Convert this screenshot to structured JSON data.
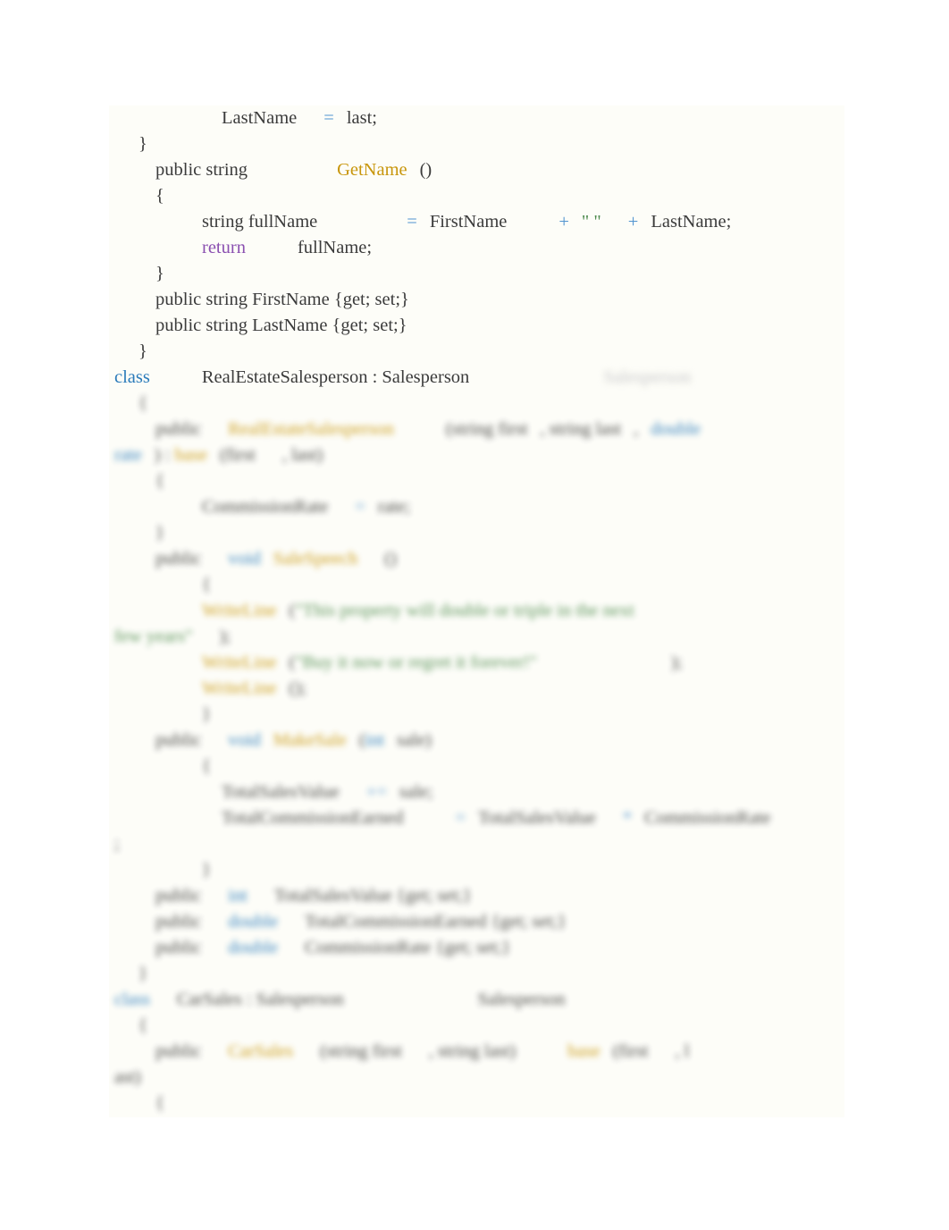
{
  "document": {
    "background_color": "#ffffff",
    "panel_color": "#fdfdf8",
    "language": "csharp",
    "syntax_colors": {
      "keyword": "#2b7bba",
      "operator": "#4f93cf",
      "return_keyword": "#8a4fb0",
      "method_name": "#c8960c",
      "string_literal": "#4c8a4c",
      "plain_text": "#3b3b3b"
    }
  },
  "code": {
    "sharp_lines": [
      {
        "id": "line-lastname-assign",
        "indent": "ind3",
        "tokens": [
          {
            "type": "plain",
            "text": "LastName"
          },
          {
            "type": "gap",
            "size": "gap-m"
          },
          {
            "type": "op",
            "text": "="
          },
          {
            "type": "gap",
            "size": "gap-s"
          },
          {
            "type": "plain",
            "text": "last;"
          }
        ]
      },
      {
        "id": "line-close-brace-ctor",
        "indent": "ind0",
        "tokens": [
          {
            "type": "plain",
            "text": "}"
          }
        ]
      },
      {
        "id": "line-getname-signature",
        "indent": "ind1",
        "tokens": [
          {
            "type": "plain",
            "text": "public string"
          },
          {
            "type": "gap",
            "size": "gap-xl"
          },
          {
            "type": "fn",
            "text": "GetName"
          },
          {
            "type": "gap",
            "size": "gap-s"
          },
          {
            "type": "plain",
            "text": "()"
          }
        ]
      },
      {
        "id": "line-open-brace-getname",
        "indent": "ind1",
        "tokens": [
          {
            "type": "plain",
            "text": "{"
          }
        ]
      },
      {
        "id": "line-fullname-assign",
        "indent": "ind2",
        "tokens": [
          {
            "type": "plain",
            "text": "string fullName"
          },
          {
            "type": "gap",
            "size": "gap-xl"
          },
          {
            "type": "op",
            "text": "="
          },
          {
            "type": "gap",
            "size": "gap-s"
          },
          {
            "type": "plain",
            "text": "FirstName"
          },
          {
            "type": "gap",
            "size": "gap-l"
          },
          {
            "type": "op",
            "text": "+"
          },
          {
            "type": "gap",
            "size": "gap-s"
          },
          {
            "type": "str",
            "text": "\" \""
          },
          {
            "type": "gap",
            "size": "gap-m"
          },
          {
            "type": "op",
            "text": "+"
          },
          {
            "type": "gap",
            "size": "gap-s"
          },
          {
            "type": "plain",
            "text": "LastName;"
          }
        ]
      },
      {
        "id": "line-return-fullname",
        "indent": "ind2",
        "tokens": [
          {
            "type": "ret",
            "text": "return"
          },
          {
            "type": "gap",
            "size": "gap-l"
          },
          {
            "type": "plain",
            "text": "fullName;"
          }
        ]
      },
      {
        "id": "line-close-brace-getname",
        "indent": "ind1",
        "tokens": [
          {
            "type": "plain",
            "text": "}"
          }
        ]
      },
      {
        "id": "line-prop-firstname",
        "indent": "ind1",
        "tokens": [
          {
            "type": "plain",
            "text": "public string FirstName {get; set;}"
          }
        ]
      },
      {
        "id": "line-prop-lastname",
        "indent": "ind1",
        "tokens": [
          {
            "type": "plain",
            "text": "public string LastName {get; set;}"
          }
        ]
      },
      {
        "id": "line-close-brace-class",
        "indent": "ind0",
        "tokens": [
          {
            "type": "plain",
            "text": "}"
          }
        ]
      },
      {
        "id": "line-class-realestatesalesperson",
        "indent": "indc",
        "tokens": [
          {
            "type": "kw",
            "text": "class"
          },
          {
            "type": "gap",
            "size": "gap-l"
          },
          {
            "type": "plain",
            "text": "RealEstateSalesperson : Salesperson"
          },
          {
            "type": "gap",
            "size": "gap-xxl"
          },
          {
            "type": "ghost",
            "text": "Salesperson"
          }
        ]
      }
    ],
    "blurred_lines": [
      {
        "id": "line-open-brace-res",
        "indent": "ind0",
        "blur": "blurred",
        "tokens": [
          {
            "type": "plain",
            "text": "{"
          }
        ]
      },
      {
        "id": "line-res-constructor",
        "indent": "ind1",
        "blur": "blurred",
        "tokens": [
          {
            "type": "plain",
            "text": "public"
          },
          {
            "type": "gap",
            "size": "gap-m"
          },
          {
            "type": "fn",
            "text": "RealEstateSalesperson"
          },
          {
            "type": "gap",
            "size": "gap-l"
          },
          {
            "type": "plain",
            "text": "(string first"
          },
          {
            "type": "gap",
            "size": "gap-s"
          },
          {
            "type": "plain",
            "text": ", string last"
          },
          {
            "type": "gap",
            "size": "gap-s"
          },
          {
            "type": "plain",
            "text": ","
          },
          {
            "type": "gap",
            "size": "gap-s"
          },
          {
            "type": "kw",
            "text": "double"
          }
        ]
      },
      {
        "id": "line-res-constructor-base",
        "indent": "indc",
        "blur": "blurred",
        "tokens": [
          {
            "type": "kw",
            "text": "rate"
          },
          {
            "type": "gap",
            "size": "gap-s"
          },
          {
            "type": "plain",
            "text": ") : "
          },
          {
            "type": "fn",
            "text": "base"
          },
          {
            "type": "gap",
            "size": "gap-s"
          },
          {
            "type": "plain",
            "text": "(first"
          },
          {
            "type": "gap",
            "size": "gap-m"
          },
          {
            "type": "plain",
            "text": ", last)"
          }
        ]
      },
      {
        "id": "line-open-brace-res-ctor",
        "indent": "ind1",
        "blur": "blurred",
        "tokens": [
          {
            "type": "plain",
            "text": "{"
          }
        ]
      },
      {
        "id": "line-commissionrate-assign",
        "indent": "ind2",
        "blur": "blurred",
        "tokens": [
          {
            "type": "plain",
            "text": "CommissionRate"
          },
          {
            "type": "gap",
            "size": "gap-m"
          },
          {
            "type": "op",
            "text": "="
          },
          {
            "type": "gap",
            "size": "gap-s"
          },
          {
            "type": "plain",
            "text": "rate;"
          }
        ]
      },
      {
        "id": "line-close-brace-res-ctor",
        "indent": "ind1",
        "blur": "blurred",
        "tokens": [
          {
            "type": "plain",
            "text": "}"
          }
        ]
      },
      {
        "id": "line-salespeech-signature",
        "indent": "ind1",
        "blur": "blurred",
        "tokens": [
          {
            "type": "plain",
            "text": "public"
          },
          {
            "type": "gap",
            "size": "gap-m"
          },
          {
            "type": "kw",
            "text": "void"
          },
          {
            "type": "gap",
            "size": "gap-s"
          },
          {
            "type": "fn",
            "text": "SaleSpeech"
          },
          {
            "type": "gap",
            "size": "gap-m"
          },
          {
            "type": "plain",
            "text": "()"
          }
        ]
      },
      {
        "id": "line-open-brace-salespeech",
        "indent": "ind2",
        "blur": "blurred",
        "tokens": [
          {
            "type": "plain",
            "text": "{"
          }
        ]
      },
      {
        "id": "line-writeline-1",
        "indent": "ind2",
        "blur": "blurred",
        "tokens": [
          {
            "type": "fn",
            "text": "WriteLine"
          },
          {
            "type": "gap",
            "size": "gap-s"
          },
          {
            "type": "plain",
            "text": "("
          },
          {
            "type": "str",
            "text": "\"This property will double or triple in the next"
          }
        ]
      },
      {
        "id": "line-writeline-1-cont",
        "indent": "indc",
        "blur": "blurred",
        "tokens": [
          {
            "type": "str",
            "text": "few years\""
          },
          {
            "type": "gap",
            "size": "gap-m"
          },
          {
            "type": "plain",
            "text": ");"
          }
        ]
      },
      {
        "id": "line-writeline-2",
        "indent": "ind2",
        "blur": "blurred",
        "tokens": [
          {
            "type": "fn",
            "text": "WriteLine"
          },
          {
            "type": "gap",
            "size": "gap-s"
          },
          {
            "type": "plain",
            "text": "("
          },
          {
            "type": "str",
            "text": "\"Buy it now or regret it forever!\""
          },
          {
            "type": "gap",
            "size": "gap-xxl"
          },
          {
            "type": "plain",
            "text": ");"
          }
        ]
      },
      {
        "id": "line-writeline-3",
        "indent": "ind2",
        "blur": "blurred",
        "tokens": [
          {
            "type": "fn",
            "text": "WriteLine"
          },
          {
            "type": "gap",
            "size": "gap-s"
          },
          {
            "type": "plain",
            "text": "();"
          }
        ]
      },
      {
        "id": "line-close-brace-salespeech",
        "indent": "ind2",
        "blur": "blurred",
        "tokens": [
          {
            "type": "plain",
            "text": "}"
          }
        ]
      },
      {
        "id": "line-makesale-signature",
        "indent": "ind1",
        "blur": "blurred",
        "tokens": [
          {
            "type": "plain",
            "text": "public"
          },
          {
            "type": "gap",
            "size": "gap-m"
          },
          {
            "type": "kw",
            "text": "void"
          },
          {
            "type": "gap",
            "size": "gap-s"
          },
          {
            "type": "fn",
            "text": "MakeSale"
          },
          {
            "type": "gap",
            "size": "gap-s"
          },
          {
            "type": "plain",
            "text": "("
          },
          {
            "type": "kw",
            "text": "int"
          },
          {
            "type": "gap",
            "size": "gap-s"
          },
          {
            "type": "plain",
            "text": "sale)"
          }
        ]
      },
      {
        "id": "line-open-brace-makesale",
        "indent": "ind2",
        "blur": "blurred",
        "tokens": [
          {
            "type": "plain",
            "text": "{"
          }
        ]
      },
      {
        "id": "line-totalsalesvalue-add",
        "indent": "ind3",
        "blur": "blurred",
        "tokens": [
          {
            "type": "plain",
            "text": "TotalSalesValue"
          },
          {
            "type": "gap",
            "size": "gap-m"
          },
          {
            "type": "op",
            "text": "+="
          },
          {
            "type": "gap",
            "size": "gap-s"
          },
          {
            "type": "plain",
            "text": "sale;"
          }
        ]
      },
      {
        "id": "line-totalcommission-assign",
        "indent": "ind3",
        "blur": "blurred",
        "tokens": [
          {
            "type": "plain",
            "text": "TotalCommissionEarned"
          },
          {
            "type": "gap",
            "size": "gap-l"
          },
          {
            "type": "op",
            "text": "="
          },
          {
            "type": "gap",
            "size": "gap-s"
          },
          {
            "type": "plain",
            "text": "TotalSalesValue"
          },
          {
            "type": "gap",
            "size": "gap-m"
          },
          {
            "type": "op",
            "text": "*"
          },
          {
            "type": "gap",
            "size": "gap-s"
          },
          {
            "type": "plain",
            "text": "CommissionRate"
          }
        ]
      },
      {
        "id": "line-totalcommission-end",
        "indent": "indc",
        "blur": "blurred",
        "tokens": [
          {
            "type": "plain",
            "text": ";"
          }
        ]
      },
      {
        "id": "line-close-brace-makesale",
        "indent": "ind2",
        "blur": "blurred",
        "tokens": [
          {
            "type": "plain",
            "text": "}"
          }
        ]
      },
      {
        "id": "line-prop-totalsalesvalue",
        "indent": "ind1",
        "blur": "blurred",
        "tokens": [
          {
            "type": "plain",
            "text": "public"
          },
          {
            "type": "gap",
            "size": "gap-m"
          },
          {
            "type": "kw",
            "text": "int"
          },
          {
            "type": "gap",
            "size": "gap-m"
          },
          {
            "type": "plain",
            "text": "TotalSalesValue {get; set;}"
          }
        ]
      },
      {
        "id": "line-prop-totalcommissionearned",
        "indent": "ind1",
        "blur": "blurred",
        "tokens": [
          {
            "type": "plain",
            "text": "public"
          },
          {
            "type": "gap",
            "size": "gap-m"
          },
          {
            "type": "kw",
            "text": "double"
          },
          {
            "type": "gap",
            "size": "gap-m"
          },
          {
            "type": "plain",
            "text": "TotalCommissionEarned {get; set;}"
          }
        ]
      },
      {
        "id": "line-prop-commissionrate",
        "indent": "ind1",
        "blur": "blurred",
        "tokens": [
          {
            "type": "plain",
            "text": "public"
          },
          {
            "type": "gap",
            "size": "gap-m"
          },
          {
            "type": "kw",
            "text": "double"
          },
          {
            "type": "gap",
            "size": "gap-m"
          },
          {
            "type": "plain",
            "text": "CommissionRate {get; set;}"
          }
        ]
      },
      {
        "id": "line-close-brace-res-class",
        "indent": "ind0",
        "blur": "blurred",
        "tokens": [
          {
            "type": "plain",
            "text": "}"
          }
        ]
      },
      {
        "id": "line-class-carsales",
        "indent": "indc",
        "blur": "blurred",
        "tokens": [
          {
            "type": "kw",
            "text": "class"
          },
          {
            "type": "gap",
            "size": "gap-m"
          },
          {
            "type": "plain",
            "text": "CarSales : Salesperson"
          },
          {
            "type": "gap",
            "size": "gap-xxl"
          },
          {
            "type": "plain",
            "text": "Salesperson"
          }
        ]
      },
      {
        "id": "line-open-brace-carsales",
        "indent": "ind0",
        "blur": "blurred",
        "tokens": [
          {
            "type": "plain",
            "text": "{"
          }
        ]
      },
      {
        "id": "line-carsales-constructor",
        "indent": "ind1",
        "blur": "blurred",
        "tokens": [
          {
            "type": "plain",
            "text": "public"
          },
          {
            "type": "gap",
            "size": "gap-m"
          },
          {
            "type": "fn",
            "text": "CarSales"
          },
          {
            "type": "gap",
            "size": "gap-m"
          },
          {
            "type": "plain",
            "text": "(string first"
          },
          {
            "type": "gap",
            "size": "gap-m"
          },
          {
            "type": "plain",
            "text": ", string last)"
          },
          {
            "type": "gap",
            "size": "gap-l"
          },
          {
            "type": "fn",
            "text": "base"
          },
          {
            "type": "gap",
            "size": "gap-s"
          },
          {
            "type": "plain",
            "text": "(first"
          },
          {
            "type": "gap",
            "size": "gap-m"
          },
          {
            "type": "plain",
            "text": ", l"
          }
        ]
      },
      {
        "id": "line-carsales-constructor-cont",
        "indent": "indc",
        "blur": "blurred",
        "tokens": [
          {
            "type": "plain",
            "text": "ast)"
          }
        ]
      },
      {
        "id": "line-open-brace-carsales-ctor",
        "indent": "ind1",
        "blur": "blurred",
        "tokens": [
          {
            "type": "plain",
            "text": "{"
          }
        ]
      }
    ]
  }
}
